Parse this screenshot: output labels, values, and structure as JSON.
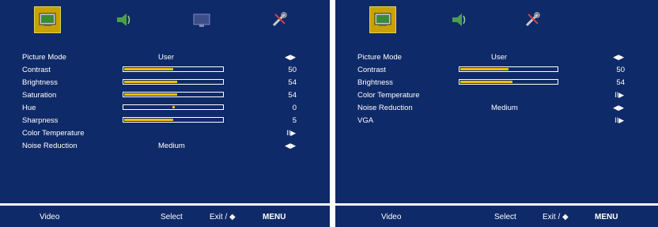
{
  "left": {
    "tabs": [
      "picture-icon",
      "audio-icon",
      "tv-icon",
      "setup-icon"
    ],
    "rows": [
      {
        "name": "picture-mode",
        "label": "Picture Mode",
        "text": "User",
        "arrow": "◀▶"
      },
      {
        "name": "contrast",
        "label": "Contrast",
        "value": "50",
        "bar": 0.5
      },
      {
        "name": "brightness",
        "label": "Brightness",
        "value": "54",
        "bar": 0.54
      },
      {
        "name": "saturation",
        "label": "Saturation",
        "value": "54",
        "bar": 0.54
      },
      {
        "name": "hue",
        "label": "Hue",
        "value": "0",
        "knob": 0.5
      },
      {
        "name": "sharpness",
        "label": "Sharpness",
        "value": "5",
        "bar": 0.5
      },
      {
        "name": "color-temperature",
        "label": "Color Temperature",
        "arrow": "II▶"
      },
      {
        "name": "noise-reduction",
        "label": "Noise Reduction",
        "text": "Medium",
        "arrow": "◀▶"
      }
    ],
    "bottom": {
      "source": "Video",
      "select": "Select",
      "move": "Exit / ◆",
      "menu": "MENU"
    }
  },
  "right": {
    "tabs": [
      "picture-icon",
      "audio-icon",
      "setup-icon"
    ],
    "rows": [
      {
        "name": "picture-mode",
        "label": "Picture Mode",
        "text": "User",
        "arrow": "◀▶"
      },
      {
        "name": "contrast",
        "label": "Contrast",
        "value": "50",
        "bar": 0.5
      },
      {
        "name": "brightness",
        "label": "Brightness",
        "value": "54",
        "bar": 0.54
      },
      {
        "name": "color-temperature",
        "label": "Color Temperature",
        "arrow": "II▶"
      },
      {
        "name": "noise-reduction",
        "label": "Noise Reduction",
        "text": "Medium",
        "arrow": "◀▶"
      },
      {
        "name": "vga",
        "label": "VGA",
        "arrow": "II▶"
      }
    ],
    "bottom": {
      "source": "Video",
      "select": "Select",
      "move": "Exit / ◆",
      "menu": "MENU"
    }
  },
  "colors": {
    "background": "#0f2a68",
    "bar": "#f0c000",
    "tab_active": "#c8a300"
  }
}
